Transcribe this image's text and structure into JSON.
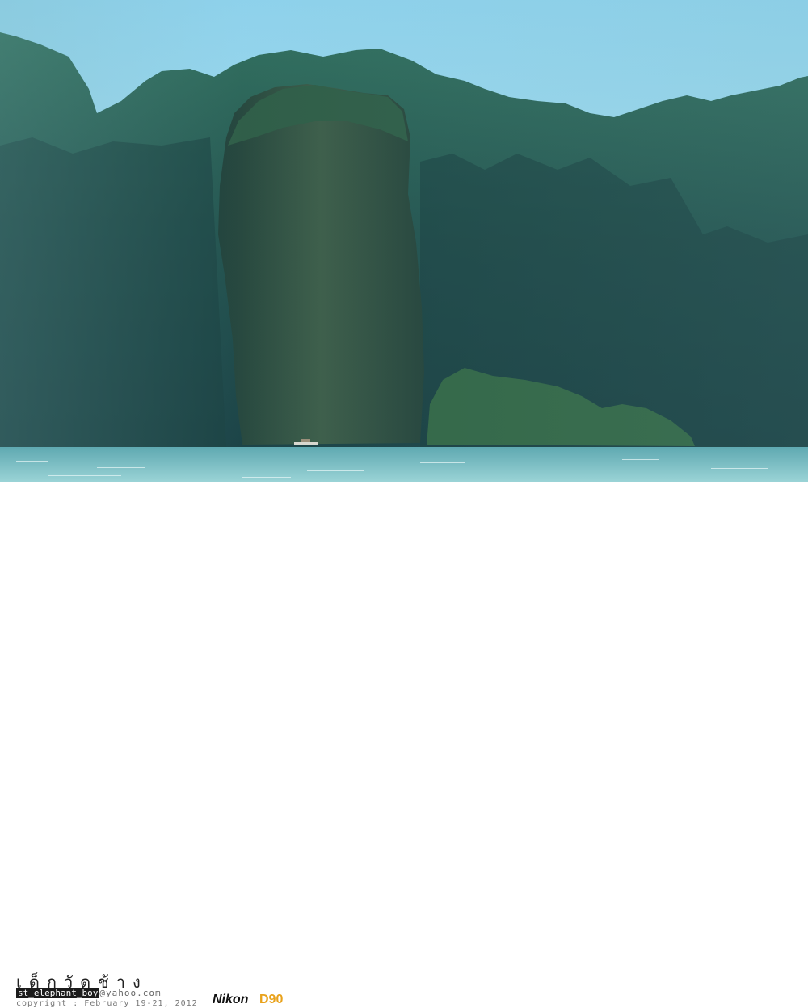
{
  "footer": {
    "thai_name": "เด็กวัดช้าง",
    "email_user": "st_elephant_boy",
    "email_domain": "@yahoo.com",
    "copyright": "copyright : February 19-21, 2012",
    "camera_brand": "Nikon",
    "camera_model": "D90"
  },
  "colors": {
    "sky": "#a9dcef",
    "cliffs": "#1b4a47",
    "sea": "#7cc3c9",
    "camera_model": "#e9a21b"
  }
}
